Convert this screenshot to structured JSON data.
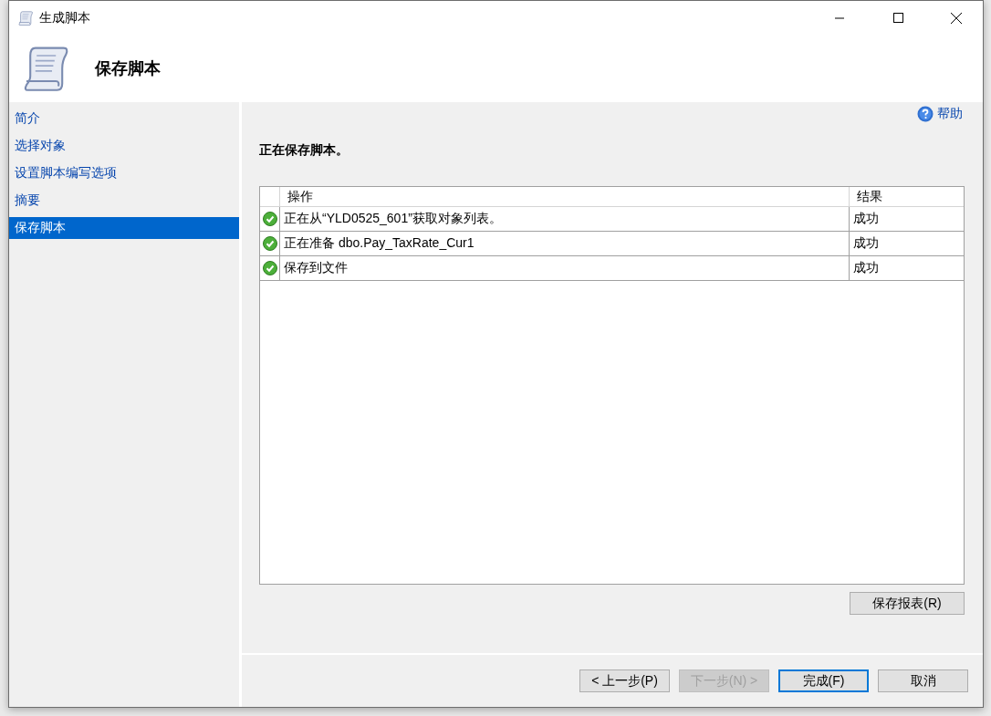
{
  "window": {
    "title": "生成脚本"
  },
  "header": {
    "title": "保存脚本"
  },
  "sidebar": {
    "items": [
      {
        "label": "简介",
        "selected": false
      },
      {
        "label": "选择对象",
        "selected": false
      },
      {
        "label": "设置脚本编写选项",
        "selected": false
      },
      {
        "label": "摘要",
        "selected": false
      },
      {
        "label": "保存脚本",
        "selected": true
      }
    ]
  },
  "help_link": "帮助",
  "status_text": "正在保存脚本。",
  "table": {
    "columns": [
      "操作",
      "结果"
    ],
    "rows": [
      {
        "succeeded": true,
        "operation": "正在从“YLD0525_601”获取对象列表。",
        "result": "成功"
      },
      {
        "succeeded": true,
        "operation": "正在准备 dbo.Pay_TaxRate_Cur1",
        "result": "成功"
      },
      {
        "succeeded": true,
        "operation": "保存到文件",
        "result": "成功"
      }
    ]
  },
  "save_report_button": "保存报表(R)",
  "buttons": [
    {
      "label": "< 上一步(P)",
      "disabled": false,
      "focused": false
    },
    {
      "label": "下一步(N) >",
      "disabled": true,
      "focused": false
    },
    {
      "label": "完成(F)",
      "disabled": false,
      "focused": true
    },
    {
      "label": "取消",
      "disabled": false,
      "focused": false
    }
  ]
}
